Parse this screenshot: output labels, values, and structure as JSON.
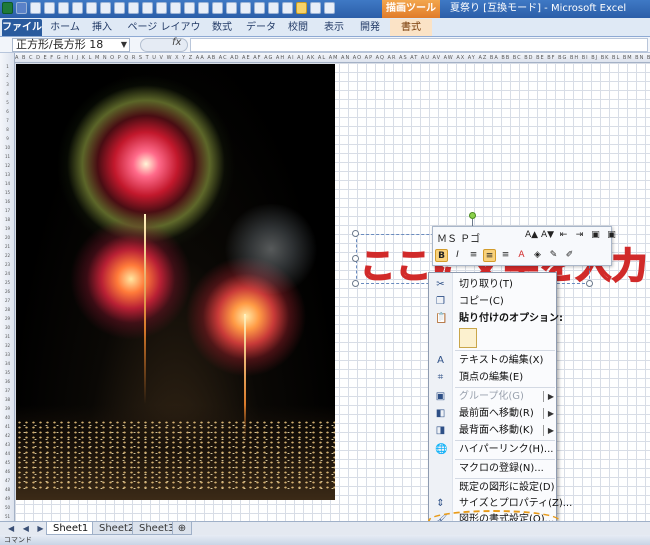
{
  "title_bar": {
    "context_tool": "描画ツール",
    "window_title": "夏祭り [互換モード] - Microsoft Excel"
  },
  "ribbon": {
    "tabs": [
      {
        "label": "ファイル"
      },
      {
        "label": "ホーム"
      },
      {
        "label": "挿入"
      },
      {
        "label": "ページ レイアウト"
      },
      {
        "label": "数式"
      },
      {
        "label": "データ"
      },
      {
        "label": "校閲"
      },
      {
        "label": "表示"
      },
      {
        "label": "開発"
      },
      {
        "label": "書式"
      }
    ]
  },
  "formula_bar": {
    "name_box": "正方形/長方形 18",
    "fx": "fx",
    "value": ""
  },
  "grid": {
    "column_labels": "A B C D E F G H I J K L M N O P Q R S T U V W X Y Z AA AB AC AD AE AF AG AH AI AJ AK AL AM AN AO AP AQ AR AS AT AU AV AW AX AY AZ BA BB BC BD BE BF BG BH BI BJ BK BL BM BN BO BP BQ BR BS BT BU BV BW BX BY BZ CA CB",
    "rows": [
      "1",
      "2",
      "3",
      "4",
      "5",
      "6",
      "7",
      "8",
      "9",
      "10",
      "11",
      "12",
      "13",
      "14",
      "15",
      "16",
      "17",
      "18",
      "19",
      "20",
      "21",
      "22",
      "23",
      "24",
      "25",
      "26",
      "27",
      "28",
      "29",
      "30",
      "31",
      "32",
      "33",
      "34",
      "35",
      "36",
      "37",
      "38",
      "39",
      "40",
      "41",
      "42",
      "43",
      "44",
      "45",
      "46",
      "47",
      "48",
      "49",
      "50",
      "51",
      "52"
    ]
  },
  "wordart": {
    "text": "ここに文字を入力"
  },
  "mini_toolbar": {
    "font": "ＭＳ Ｐゴ",
    "row1": [
      "A▲",
      "A▼",
      "⇤",
      "⇥",
      "▣",
      "▣"
    ],
    "row2": [
      "B",
      "I",
      "≡",
      "≡",
      "≡",
      "A",
      "◈",
      "✎",
      "✐"
    ]
  },
  "context_menu": {
    "items": [
      {
        "label": "切り取り(T)",
        "icon": "scissors-icon",
        "glyph": "✂"
      },
      {
        "label": "コピー(C)",
        "icon": "copy-icon",
        "glyph": "❐"
      },
      {
        "label": "貼り付けのオプション:",
        "icon": "paste-icon",
        "glyph": "📋"
      },
      {
        "label": "テキストの編集(X)",
        "icon": "edit-text-icon",
        "glyph": "A"
      },
      {
        "label": "頂点の編集(E)",
        "icon": "edit-points-icon",
        "glyph": "⌗"
      },
      {
        "label": "グループ化(G)",
        "icon": "group-icon",
        "glyph": "▣"
      },
      {
        "label": "最前面へ移動(R)",
        "icon": "bring-front-icon",
        "glyph": "◧"
      },
      {
        "label": "最背面へ移動(K)",
        "icon": "send-back-icon",
        "glyph": "◨"
      },
      {
        "label": "ハイパーリンク(H)...",
        "icon": "hyperlink-icon",
        "glyph": "🌐"
      },
      {
        "label": "マクロの登録(N)...",
        "icon": "",
        "glyph": ""
      },
      {
        "label": "既定の図形に設定(D)",
        "icon": "",
        "glyph": ""
      },
      {
        "label": "サイズとプロパティ(Z)...",
        "icon": "size-props-icon",
        "glyph": "⇕"
      },
      {
        "label": "図形の書式設定(O)...",
        "icon": "format-shape-icon",
        "glyph": "🖌"
      }
    ]
  },
  "sheet_tabs": {
    "nav": "◀ ◀ ▶ ▶",
    "sheets": [
      "Sheet1",
      "Sheet2",
      "Sheet3"
    ],
    "new_sheet": "⊕"
  },
  "status_bar": {
    "mode": "コマンド"
  },
  "colors": {
    "file_tab": "#2a5b9e",
    "wordart_stroke": "#d12a2a",
    "highlight": "#e89b1a",
    "context_tool": "#e07b2a"
  }
}
